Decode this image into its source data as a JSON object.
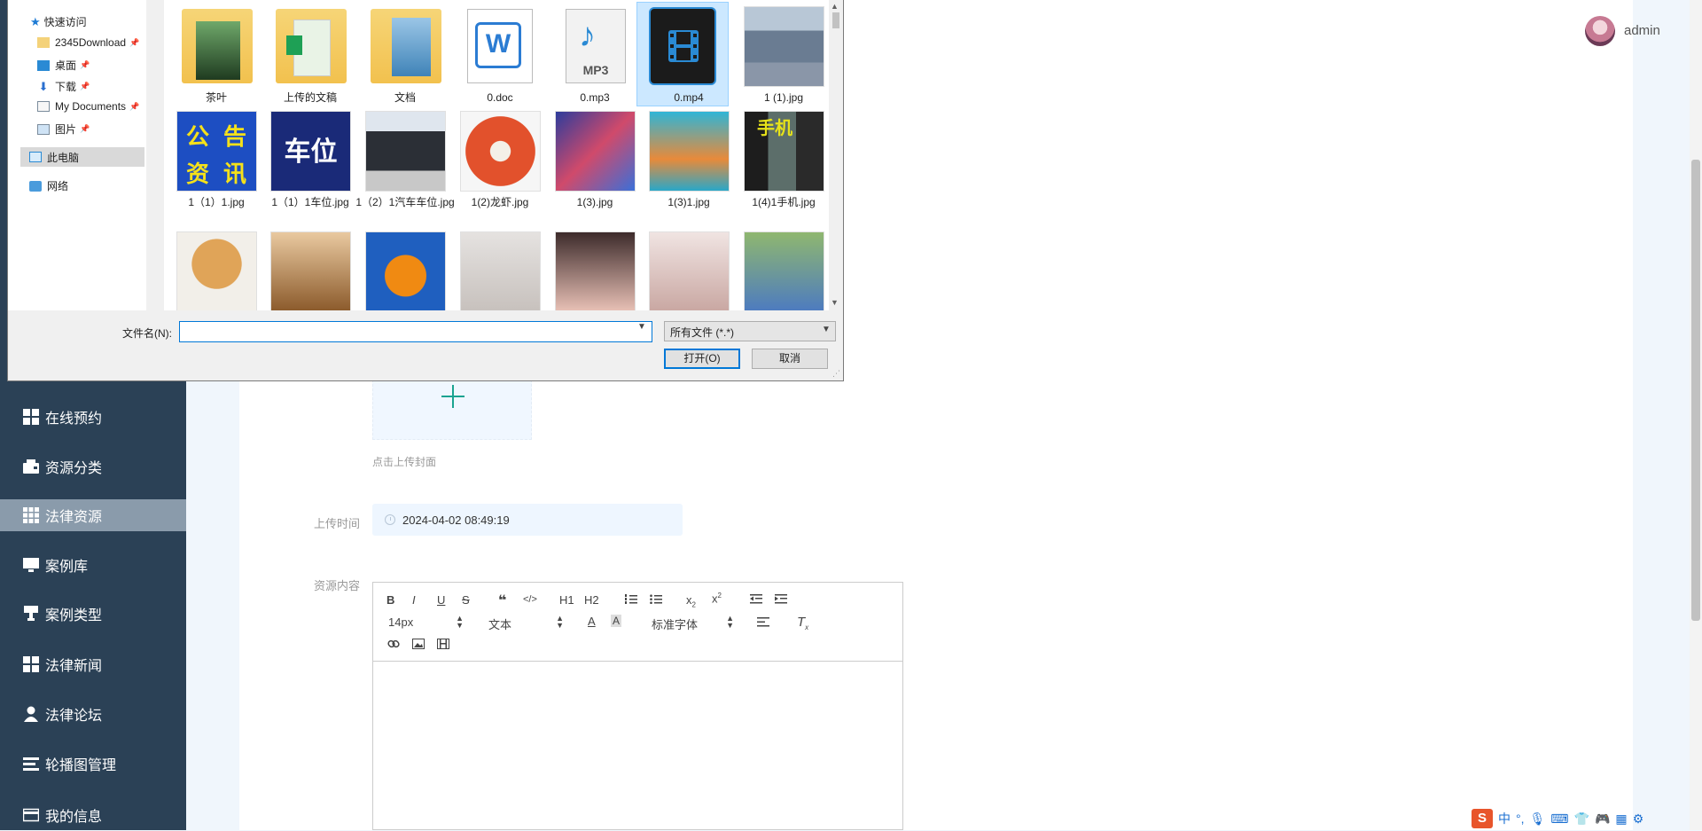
{
  "header": {
    "username": "admin"
  },
  "sidebar": {
    "items": [
      {
        "label": "在线预约",
        "icon": "grid-icon"
      },
      {
        "label": "资源分类",
        "icon": "wallet-icon"
      },
      {
        "label": "法律资源",
        "icon": "grid-icon",
        "active": true
      },
      {
        "label": "案例库",
        "icon": "monitor-icon"
      },
      {
        "label": "案例类型",
        "icon": "stamp-icon"
      },
      {
        "label": "法律新闻",
        "icon": "grid-icon"
      },
      {
        "label": "法律论坛",
        "icon": "user-icon"
      },
      {
        "label": "轮播图管理",
        "icon": "list-icon"
      },
      {
        "label": "我的信息",
        "icon": "card-icon"
      }
    ]
  },
  "form": {
    "cover_hint": "点击上传封面",
    "upload_time_label": "上传时间",
    "upload_time_value": "2024-04-02 08:49:19",
    "content_label": "资源内容"
  },
  "editor": {
    "font_size": "14px",
    "block_type": "文本",
    "font_family": "标准字体",
    "buttons": [
      "B",
      "I",
      "U",
      "S",
      "❝",
      "</>",
      "H1",
      "H2"
    ]
  },
  "dialog": {
    "nav": {
      "quick_access": "快速访问",
      "items": [
        "2345Download",
        "桌面",
        "下载",
        "My Documents",
        "图片"
      ],
      "this_pc": "此电脑",
      "network": "网络"
    },
    "files": [
      "茶叶",
      "上传的文稿",
      "文档",
      "0.doc",
      "0.mp3",
      "0.mp4",
      "1 (1).jpg",
      "1（1）1.jpg",
      "1（1）1车位.jpg",
      "1（2）1汽车车位.jpg",
      "1(2)龙虾.jpg",
      "1(3).jpg",
      "1(3)1.jpg",
      "1(4)1手机.jpg",
      "",
      "",
      "",
      "",
      "",
      "",
      ""
    ],
    "thumb_text": {
      "notice": [
        "公",
        "告",
        "资",
        "讯"
      ],
      "parking": "车位",
      "phone": "手机",
      "mp3": "MP3"
    },
    "filename_label": "文件名(N):",
    "filename_value": "",
    "filetype": "所有文件 (*.*)",
    "open_label": "打开(O)",
    "cancel_label": "取消"
  },
  "tray": {
    "ime": "中"
  },
  "colors": {
    "sidebar": "#2b4156",
    "active_item": "#8a9bab",
    "accent": "#0078d7",
    "plus": "#1aa391"
  }
}
